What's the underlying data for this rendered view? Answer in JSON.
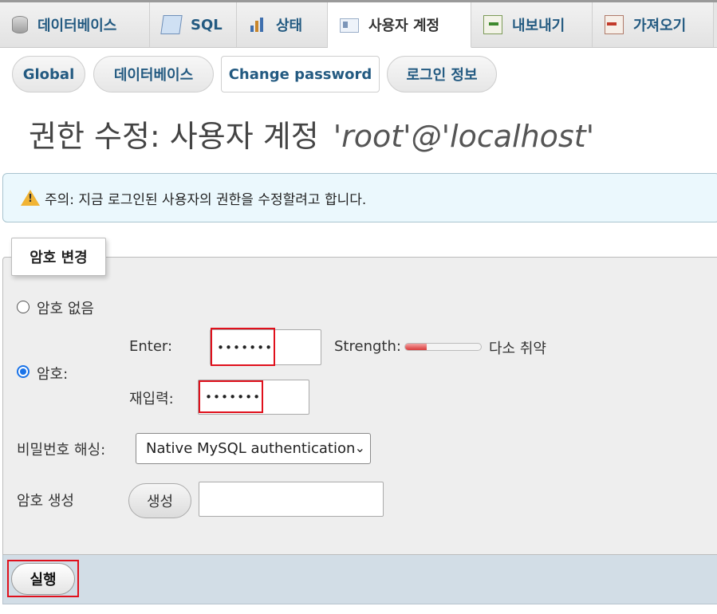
{
  "tabs": [
    {
      "label": "데이터베이스",
      "icon": "database-icon"
    },
    {
      "label": "SQL",
      "icon": "sql-icon"
    },
    {
      "label": "상태",
      "icon": "status-icon"
    },
    {
      "label": "사용자 계정",
      "icon": "user-accounts-icon",
      "active": true
    },
    {
      "label": "내보내기",
      "icon": "export-icon"
    },
    {
      "label": "가져오기",
      "icon": "import-icon"
    }
  ],
  "subnav": [
    {
      "label": "Global"
    },
    {
      "label": "데이터베이스"
    },
    {
      "label": "Change password",
      "active": true
    },
    {
      "label": "로그인 정보"
    }
  ],
  "page": {
    "title_prefix": "권한 수정: 사용자 계정",
    "title_user": "'root'@'localhost'"
  },
  "notice": {
    "text": "주의: 지금 로그인된 사용자의 권한을 수정할려고 합니다."
  },
  "form": {
    "legend": "암호 변경",
    "no_password_label": "암호 없음",
    "password_label": "암호:",
    "enter_label": "Enter:",
    "enter_value": "•••••••",
    "strength_label": "Strength:",
    "strength_text": "다소 취약",
    "strength_level": 0.28,
    "reenter_label": "재입력:",
    "reenter_value": "•••••••",
    "hashing_label": "비밀번호 해싱:",
    "hashing_selected": "Native MySQL authentication",
    "generate_label": "암호 생성",
    "generate_button": "생성",
    "generated_value": "",
    "submit_button": "실행"
  },
  "colors": {
    "link_blue": "#235a81",
    "notice_bg": "#ebf8fd",
    "highlight_red": "#e0101c",
    "footer_bg": "#d2dde6"
  }
}
